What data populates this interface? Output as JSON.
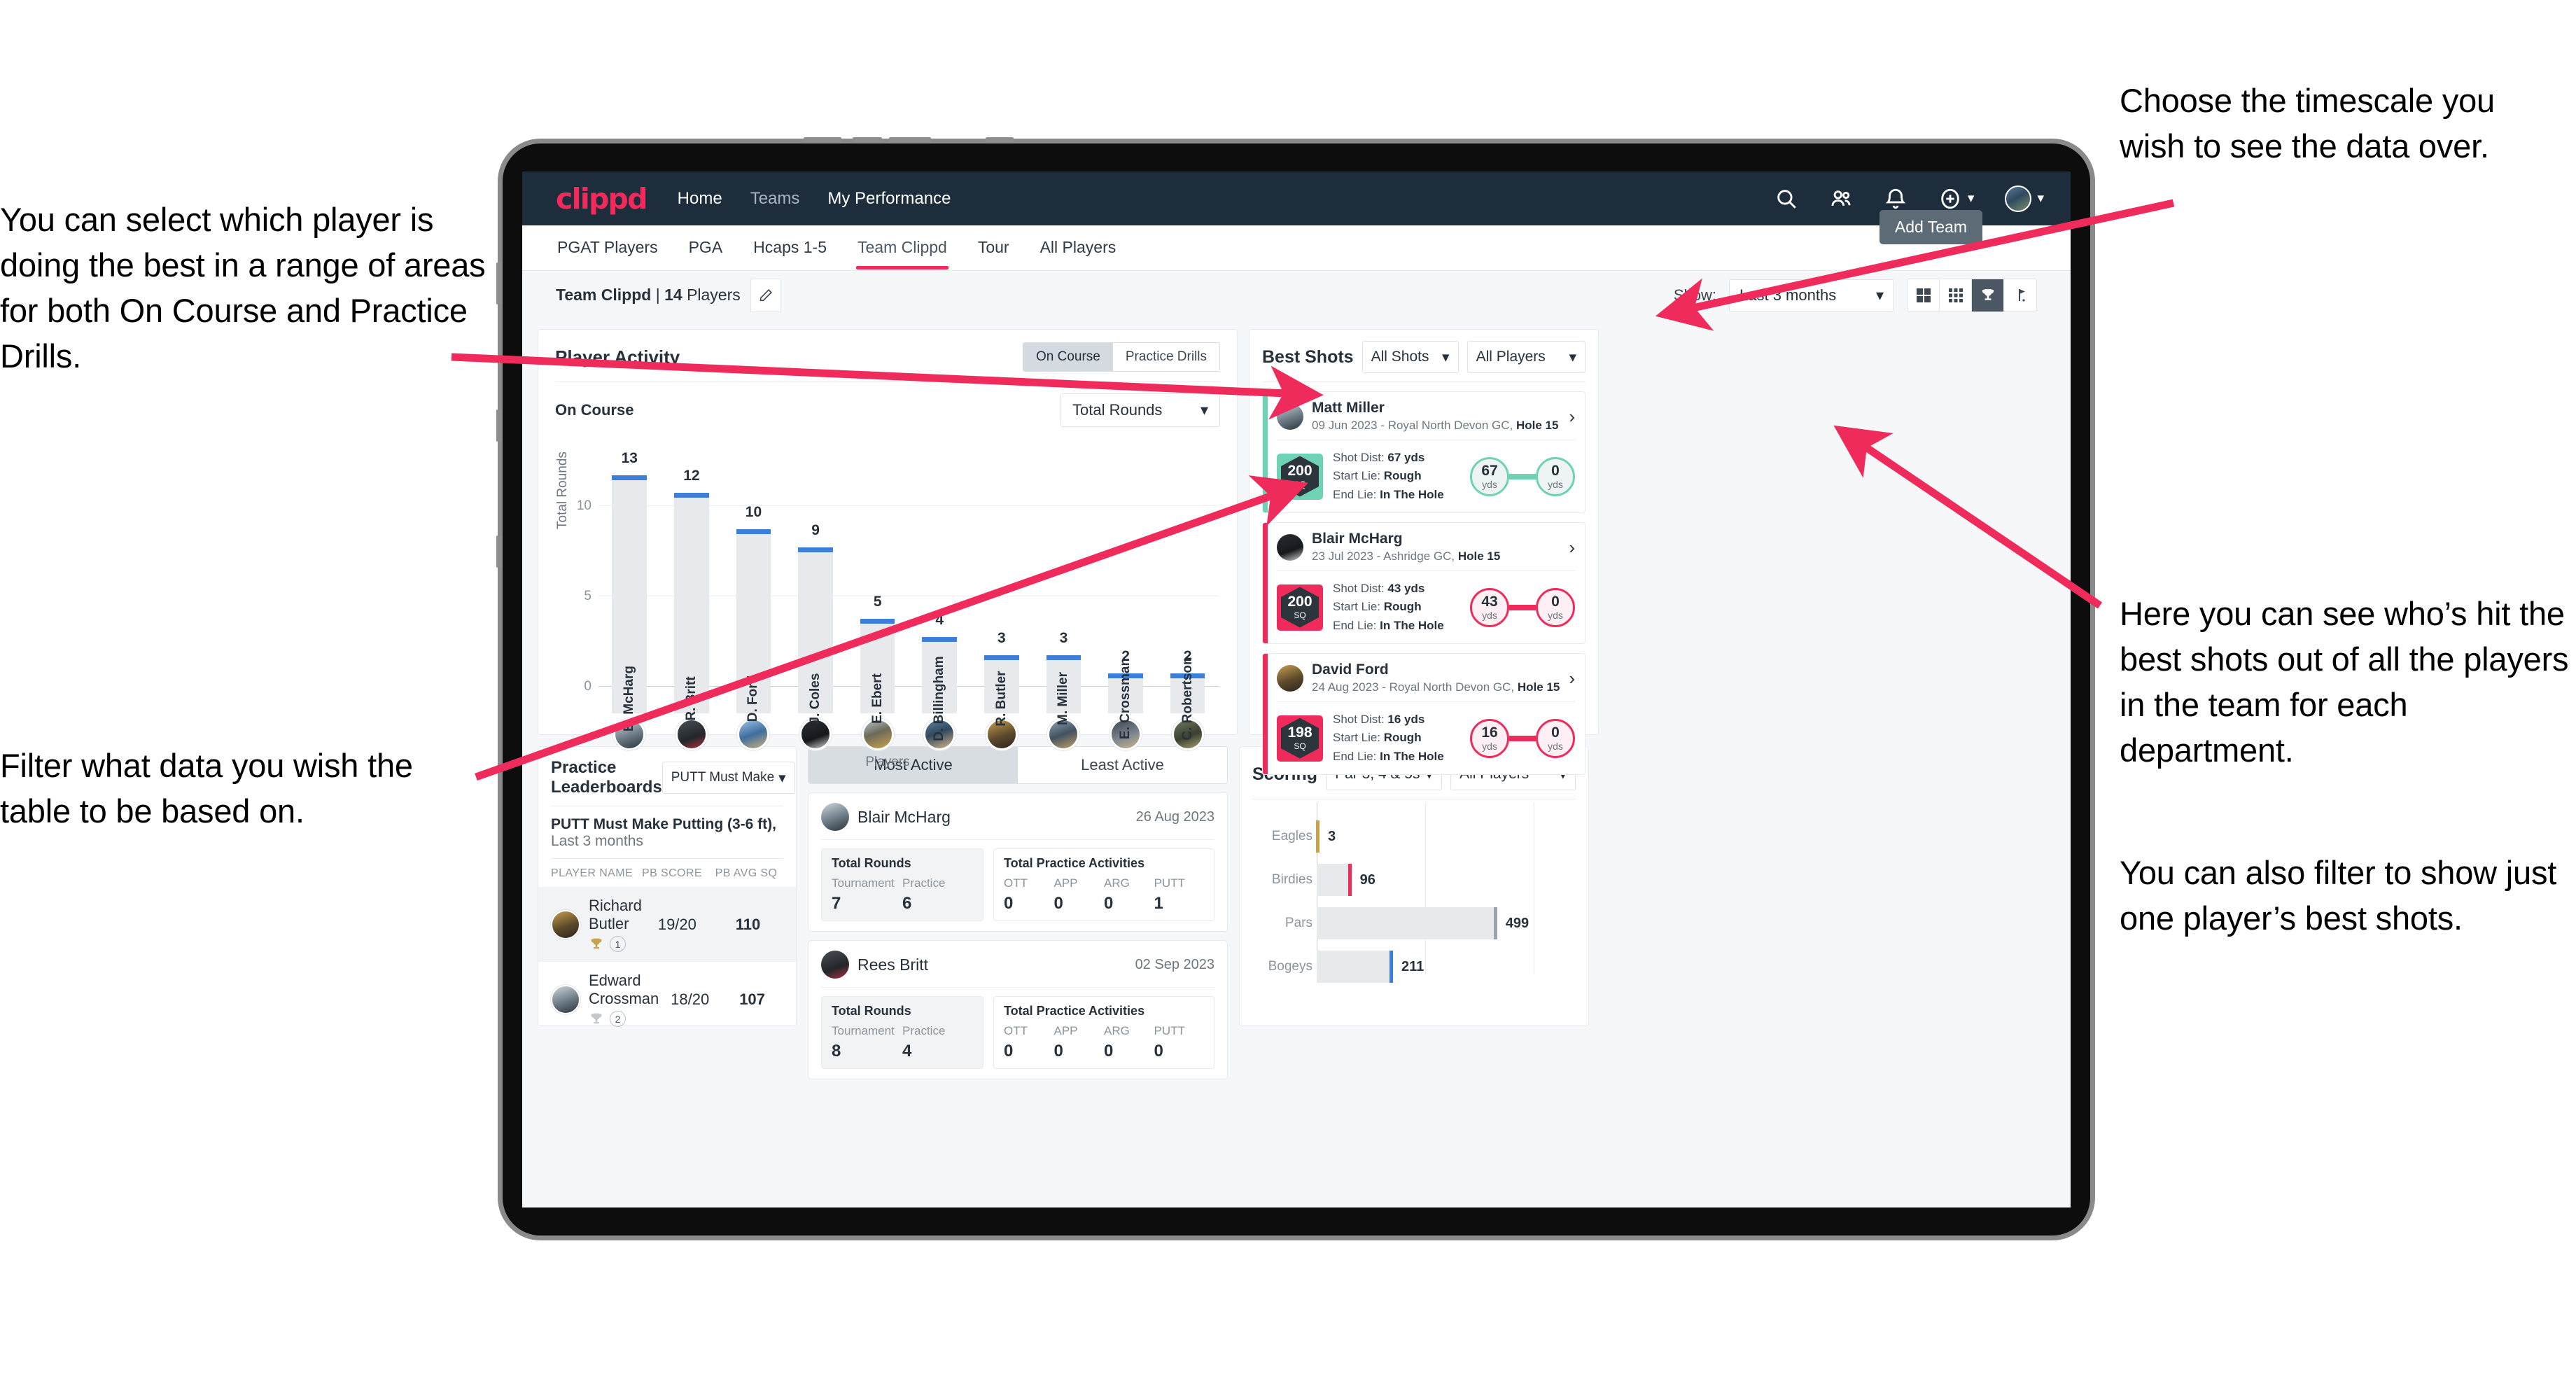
{
  "annotations": {
    "top_left": "You can select which player is doing the best in a range of areas for both On Course and Practice Drills.",
    "bottom_left": "Filter what data you wish the table to be based on.",
    "top_right": "Choose the timescale you wish to see the data over.",
    "middle_right": "Here you can see who’s hit the best shots out of all the players in the team for each department.",
    "middle_right_2": "You can also filter to show just one player’s best shots."
  },
  "appbar": {
    "logo": "clippd",
    "links": [
      {
        "label": "Home",
        "dim": false
      },
      {
        "label": "Teams",
        "dim": true
      },
      {
        "label": "My Performance",
        "dim": false
      }
    ],
    "icons": [
      "search-icon",
      "people-icon",
      "bell-icon",
      "plus-circle-icon",
      "avatar"
    ]
  },
  "tabs": {
    "items": [
      {
        "label": "PGAT Players",
        "active": false
      },
      {
        "label": "PGA",
        "active": false
      },
      {
        "label": "Hcaps 1-5",
        "active": false
      },
      {
        "label": "Team Clippd",
        "active": true
      },
      {
        "label": "Tour",
        "active": false
      },
      {
        "label": "All Players",
        "active": false
      }
    ],
    "tooltip": "Add Team"
  },
  "toolbar": {
    "team_name": "Team Clippd",
    "team_sep": " | ",
    "player_count": "14",
    "players_word": "Players",
    "edit_icon": "pencil-icon",
    "show_label": "Show:",
    "timescale_value": "Last 3 months",
    "view_buttons": [
      {
        "name": "grid-large-icon",
        "active": false
      },
      {
        "name": "grid-small-icon",
        "active": false
      },
      {
        "name": "trophy-icon",
        "active": true
      },
      {
        "name": "golf-flag-icon",
        "active": false
      }
    ]
  },
  "player_activity": {
    "title": "Player Activity",
    "segments": [
      {
        "label": "On Course",
        "active": true
      },
      {
        "label": "Practice Drills",
        "active": false
      }
    ],
    "sub_title": "On Course",
    "metric_select": "Total Rounds"
  },
  "best_shots": {
    "title": "Best Shots",
    "shot_filter": "All Shots",
    "player_filter": "All Players",
    "cards": [
      {
        "player": "Matt Miller",
        "meta_prefix": "09 Jun 2023 - Royal North Devon GC, ",
        "meta_hole": "Hole 15",
        "score": "200",
        "score_unit": "SQ",
        "accent": "#6ed3b4",
        "shot_dist_label": "Shot Dist: ",
        "shot_dist": "67 yds",
        "start_lie_label": "Start Lie: ",
        "start_lie": "Rough",
        "end_lie_label": "End Lie: ",
        "end_lie": "In The Hole",
        "from_value": "67",
        "from_unit": "yds",
        "to_value": "0",
        "to_unit": "yds"
      },
      {
        "player": "Blair McHarg",
        "meta_prefix": "23 Jul 2023 - Ashridge GC, ",
        "meta_hole": "Hole 15",
        "score": "200",
        "score_unit": "SQ",
        "accent": "#ef2b5c",
        "shot_dist_label": "Shot Dist: ",
        "shot_dist": "43 yds",
        "start_lie_label": "Start Lie: ",
        "start_lie": "Rough",
        "end_lie_label": "End Lie: ",
        "end_lie": "In The Hole",
        "from_value": "43",
        "from_unit": "yds",
        "to_value": "0",
        "to_unit": "yds"
      },
      {
        "player": "David Ford",
        "meta_prefix": "24 Aug 2023 - Royal North Devon GC, ",
        "meta_hole": "Hole 15",
        "score": "198",
        "score_unit": "SQ",
        "accent": "#ef2b5c",
        "shot_dist_label": "Shot Dist: ",
        "shot_dist": "16 yds",
        "start_lie_label": "Start Lie: ",
        "start_lie": "Rough",
        "end_lie_label": "End Lie: ",
        "end_lie": "In The Hole",
        "from_value": "16",
        "from_unit": "yds",
        "to_value": "0",
        "to_unit": "yds"
      }
    ]
  },
  "practice_leaderboards": {
    "title": "Practice Leaderboards",
    "drill_select": "PUTT Must Make Putting ...",
    "sub_bold": "PUTT Must Make Putting (3-6 ft),",
    "sub_light": " Last 3 months",
    "columns": [
      "PLAYER NAME",
      "PB SCORE",
      "PB AVG SQ"
    ],
    "rows": [
      {
        "name": "Richard Butler",
        "rank": "1",
        "trophy_color": "#c6a24a",
        "pb_score": "19/20",
        "pb_avg_sq": "110",
        "highlight": true
      },
      {
        "name": "Edward Crossman",
        "rank": "2",
        "trophy_color": "#c3c8cd",
        "pb_score": "18/20",
        "pb_avg_sq": "107",
        "highlight": false
      }
    ]
  },
  "activity_panel": {
    "tabs": [
      {
        "label": "Most Active",
        "active": true
      },
      {
        "label": "Least Active",
        "active": false
      }
    ],
    "cards": [
      {
        "player": "Blair McHarg",
        "date": "26 Aug 2023",
        "rounds_title": "Total Rounds",
        "rounds": [
          {
            "label": "Tournament",
            "value": "7"
          },
          {
            "label": "Practice",
            "value": "6"
          }
        ],
        "practice_title": "Total Practice Activities",
        "practice": [
          {
            "label": "OTT",
            "value": "0"
          },
          {
            "label": "APP",
            "value": "0"
          },
          {
            "label": "ARG",
            "value": "0"
          },
          {
            "label": "PUTT",
            "value": "1"
          }
        ]
      },
      {
        "player": "Rees Britt",
        "date": "02 Sep 2023",
        "rounds_title": "Total Rounds",
        "rounds": [
          {
            "label": "Tournament",
            "value": "8"
          },
          {
            "label": "Practice",
            "value": "4"
          }
        ],
        "practice_title": "Total Practice Activities",
        "practice": [
          {
            "label": "OTT",
            "value": "0"
          },
          {
            "label": "APP",
            "value": "0"
          },
          {
            "label": "ARG",
            "value": "0"
          },
          {
            "label": "PUTT",
            "value": "0"
          }
        ]
      }
    ]
  },
  "scoring": {
    "title": "Scoring",
    "par_filter": "Par 3, 4 & 5s",
    "player_filter": "All Players"
  },
  "chart_data": [
    {
      "type": "bar",
      "title": "Player Activity — On Course",
      "xlabel": "Players",
      "ylabel": "Total Rounds",
      "ylim": [
        0,
        14
      ],
      "yticks": [
        0,
        5,
        10
      ],
      "grid": true,
      "bar_color": "#e7e9ed",
      "cap_color": "#3d7ddb",
      "categories": [
        "B. McHarg",
        "R. Britt",
        "D. Ford",
        "J. Coles",
        "E. Ebert",
        "D. Billingham",
        "R. Butler",
        "M. Miller",
        "E. Crossman",
        "C. Robertson"
      ],
      "values": [
        13,
        12,
        10,
        9,
        5,
        4,
        3,
        3,
        2,
        2
      ]
    },
    {
      "type": "bar",
      "orientation": "horizontal",
      "title": "Scoring",
      "categories": [
        "Eagles",
        "Birdies",
        "Pars",
        "Bogeys"
      ],
      "values": [
        3,
        96,
        499,
        211
      ],
      "tip_colors": [
        "#c6a24a",
        "#ef2b5c",
        "#9aa2aa",
        "#3d7ddb"
      ],
      "bar_color": "#e7e9ed",
      "xlim": [
        0,
        600
      ],
      "grid": true
    }
  ]
}
